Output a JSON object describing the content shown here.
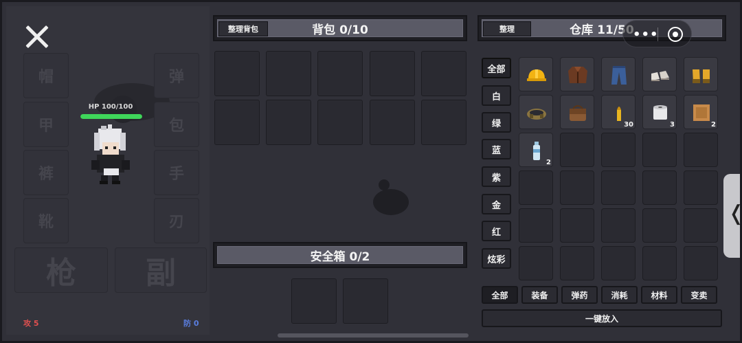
{
  "equipment": {
    "slots": {
      "hat": "帽",
      "vest": "甲",
      "pants": "裤",
      "boots": "靴",
      "ammo": "弹",
      "bag": "包",
      "hand": "手",
      "blade": "刃",
      "gun": "枪",
      "secondary": "副"
    },
    "hp_text": "HP 100/100",
    "hp_fraction": 1.0,
    "attack": "攻 5",
    "defense": "防 0"
  },
  "backpack": {
    "sort_label": "整理背包",
    "title": "背包 0/10"
  },
  "safebox": {
    "title": "安全箱 0/2"
  },
  "warehouse": {
    "sort_label": "整理",
    "title": "仓库 11/50",
    "rarity_tabs": [
      "全部",
      "白",
      "绿",
      "蓝",
      "紫",
      "金",
      "红",
      "炫彩"
    ],
    "category_tabs": [
      "全部",
      "装备",
      "弹药",
      "消耗",
      "材料",
      "变卖"
    ],
    "put_all_label": "一键放入",
    "items": [
      {
        "name": "hard-hat",
        "qty": ""
      },
      {
        "name": "leather-jacket",
        "qty": ""
      },
      {
        "name": "jeans",
        "qty": ""
      },
      {
        "name": "sneakers",
        "qty": ""
      },
      {
        "name": "gloves",
        "qty": ""
      },
      {
        "name": "belt",
        "qty": ""
      },
      {
        "name": "satchel",
        "qty": ""
      },
      {
        "name": "bullet",
        "qty": "30"
      },
      {
        "name": "bandage-roll",
        "qty": "3"
      },
      {
        "name": "biscuit",
        "qty": "2"
      },
      {
        "name": "water-bottle",
        "qty": "2"
      }
    ]
  },
  "system": {
    "more_label": "•••"
  },
  "colors": {
    "hp": "#3fd65a",
    "attack": "#e05050",
    "defense": "#5a7ee0"
  }
}
